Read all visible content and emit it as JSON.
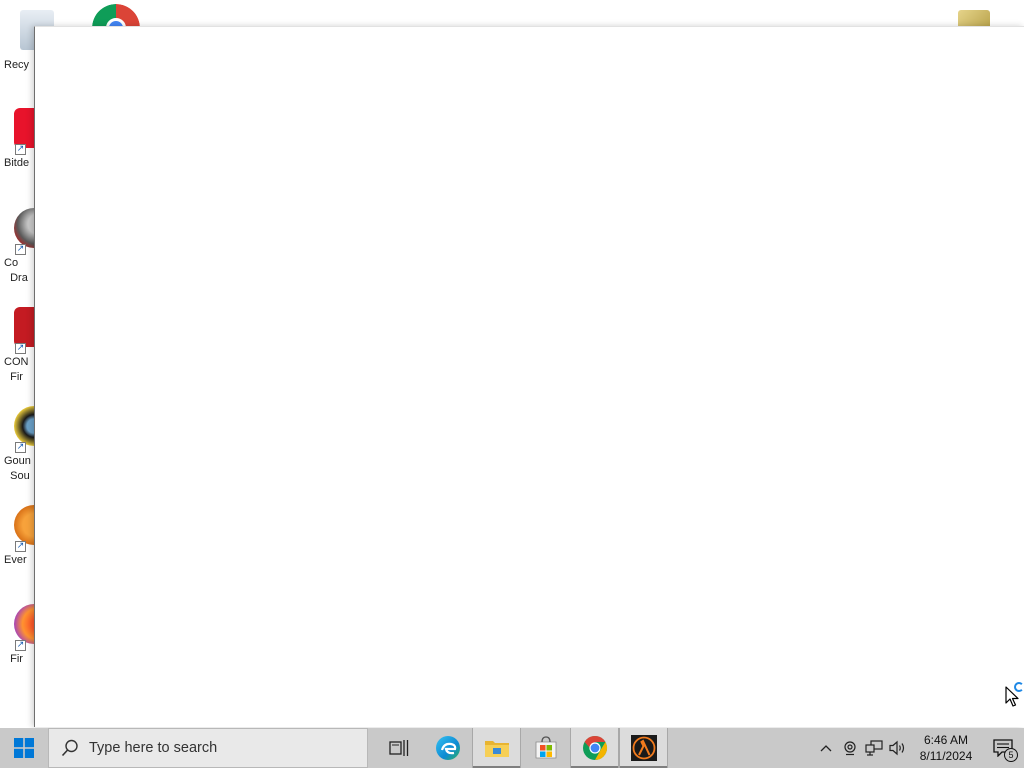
{
  "desktop": {
    "icons": [
      {
        "name": "recycle-bin",
        "label": "Recy"
      },
      {
        "name": "bitdefender",
        "label": "Bitde"
      },
      {
        "name": "connection-drawing",
        "label": "Co\n  Dra"
      },
      {
        "name": "connection-first",
        "label": "CON\n  Fir"
      },
      {
        "name": "goldwave",
        "label": "Goun\n  Sou"
      },
      {
        "name": "everything",
        "label": "Ever"
      },
      {
        "name": "firefox",
        "label": "  Fir"
      }
    ]
  },
  "taskbar": {
    "search_placeholder": "Type here to search",
    "clock_time": "6:46 AM",
    "clock_date": "8/11/2024",
    "notification_count": "5"
  },
  "colors": {
    "taskbar_bg": "#c9c9c9",
    "windows_blue": "#0078d7",
    "edge_blue": "#0c8ad3",
    "half_life_orange": "#f07a1d"
  }
}
